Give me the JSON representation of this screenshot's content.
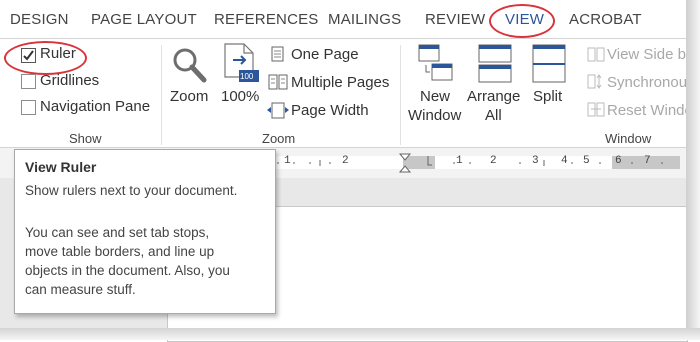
{
  "tabs": [
    "DESIGN",
    "PAGE LAYOUT",
    "REFERENCES",
    "MAILINGS",
    "REVIEW",
    "VIEW",
    "ACROBAT"
  ],
  "show_group": {
    "label": "Show",
    "items": [
      {
        "label": "Ruler",
        "checked": true
      },
      {
        "label": "Gridlines",
        "checked": false
      },
      {
        "label": "Navigation Pane",
        "checked": false
      }
    ]
  },
  "zoom_group": {
    "label": "Zoom",
    "zoom_label": "Zoom",
    "percent_label": "100%",
    "one_page": "One Page",
    "multiple_pages": "Multiple Pages",
    "page_width": "Page Width",
    "percent_badge": "100"
  },
  "window_group": {
    "label": "Window",
    "new_window_line1": "New",
    "new_window_line2": "Window",
    "arrange_all_line1": "Arrange",
    "arrange_all_line2": "All",
    "split": "Split",
    "view_side_by_side": "View Side b",
    "synchronous": "Synchronou",
    "reset_window": "Reset Windo"
  },
  "ruler_numbers": [
    "1",
    "2",
    "1",
    "2",
    "3",
    "4",
    "5",
    "6",
    "7"
  ],
  "tooltip": {
    "title": "View Ruler",
    "line1": "Show rulers next to your document.",
    "line2": "You can see and set tab stops,",
    "line3": "move table borders, and line up",
    "line4": "objects in the document. Also, you",
    "line5": "can measure stuff."
  },
  "colors": {
    "accent": "#2b579a",
    "highlight": "#d9343b"
  }
}
